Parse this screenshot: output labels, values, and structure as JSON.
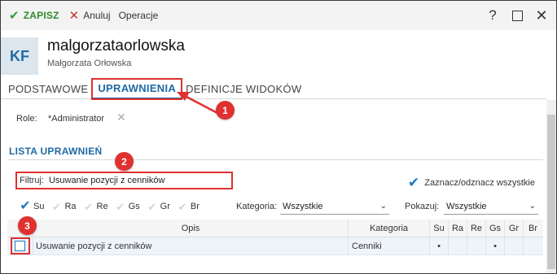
{
  "toolbar": {
    "save_label": "ZAPISZ",
    "cancel_label": "Anuluj",
    "operations_label": "Operacje",
    "help_glyph": "?",
    "close_glyph": "✕"
  },
  "user": {
    "initials": "KF",
    "username": "malgorzataorlowska",
    "full_name": "Małgorzata Orłowska"
  },
  "tabs": [
    {
      "label": "PODSTAWOWE",
      "active": false
    },
    {
      "label": "UPRAWNIENIA",
      "active": true
    },
    {
      "label": "DEFINICJE WIDOKÓW",
      "active": false
    }
  ],
  "roles": {
    "label": "Role:",
    "value": "*Administrator"
  },
  "permissions": {
    "section_title": "LISTA UPRAWNIEŃ",
    "filter_label": "Filtruj:",
    "filter_value": "Usuwanie pozycji z cenników",
    "toggle_all_label": "Zaznacz/odznacz wszystkie",
    "types": [
      {
        "label": "Su",
        "checked": true
      },
      {
        "label": "Ra",
        "checked": false
      },
      {
        "label": "Re",
        "checked": false
      },
      {
        "label": "Gs",
        "checked": false
      },
      {
        "label": "Gr",
        "checked": false
      },
      {
        "label": "Br",
        "checked": false
      }
    ],
    "category_label": "Kategoria:",
    "category_value": "Wszystkie",
    "show_label": "Pokazuj:",
    "show_value": "Wszystkie"
  },
  "table": {
    "columns": [
      "Opis",
      "Kategoria",
      "Su",
      "Ra",
      "Re",
      "Gs",
      "Gr",
      "Br"
    ],
    "rows": [
      {
        "description": "Usuwanie pozycji z cenników",
        "category": "Cenniki",
        "su": "•",
        "ra": "",
        "re": "",
        "gs": "•",
        "gr": "",
        "br": ""
      }
    ]
  },
  "annotations": [
    "1",
    "2",
    "3"
  ],
  "colors": {
    "accent": "#1f6aa5",
    "highlight": "#e03030",
    "save": "#2e8b2e"
  }
}
